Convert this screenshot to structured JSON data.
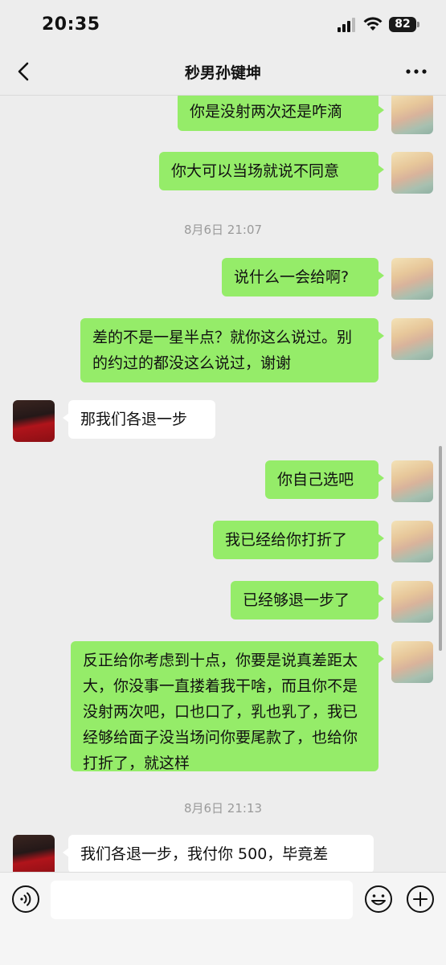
{
  "status_bar": {
    "time": "20:35",
    "battery": "82"
  },
  "header": {
    "title": "秒男孙键坤"
  },
  "messages": [
    {
      "side": "me",
      "text": "你是没射两次还是咋滴"
    },
    {
      "side": "me",
      "text": "你大可以当场就说不同意"
    },
    {
      "type": "time",
      "text": "8月6日 21:07"
    },
    {
      "side": "me",
      "text": "说什么一会给啊?"
    },
    {
      "side": "me",
      "text": "差的不是一星半点？就你这么说过。别的约过的都没这么说过，谢谢"
    },
    {
      "side": "them",
      "text": "那我们各退一步"
    },
    {
      "side": "me",
      "text": "你自己选吧"
    },
    {
      "side": "me",
      "text": "我已经给你打折了"
    },
    {
      "side": "me",
      "text": "已经够退一步了"
    },
    {
      "side": "me",
      "text": "反正给你考虑到十点，你要是说真差距太大，你没事一直搂着我干啥，而且你不是没射两次吧，口也口了，乳也乳了，我已经够给面子没当场问你要尾款了，也给你打折了，就这样"
    },
    {
      "type": "time",
      "text": "8月6日 21:13"
    },
    {
      "side": "them",
      "text": "我们各退一步，我付你 500，毕竟差"
    }
  ],
  "input": {
    "placeholder": ""
  }
}
